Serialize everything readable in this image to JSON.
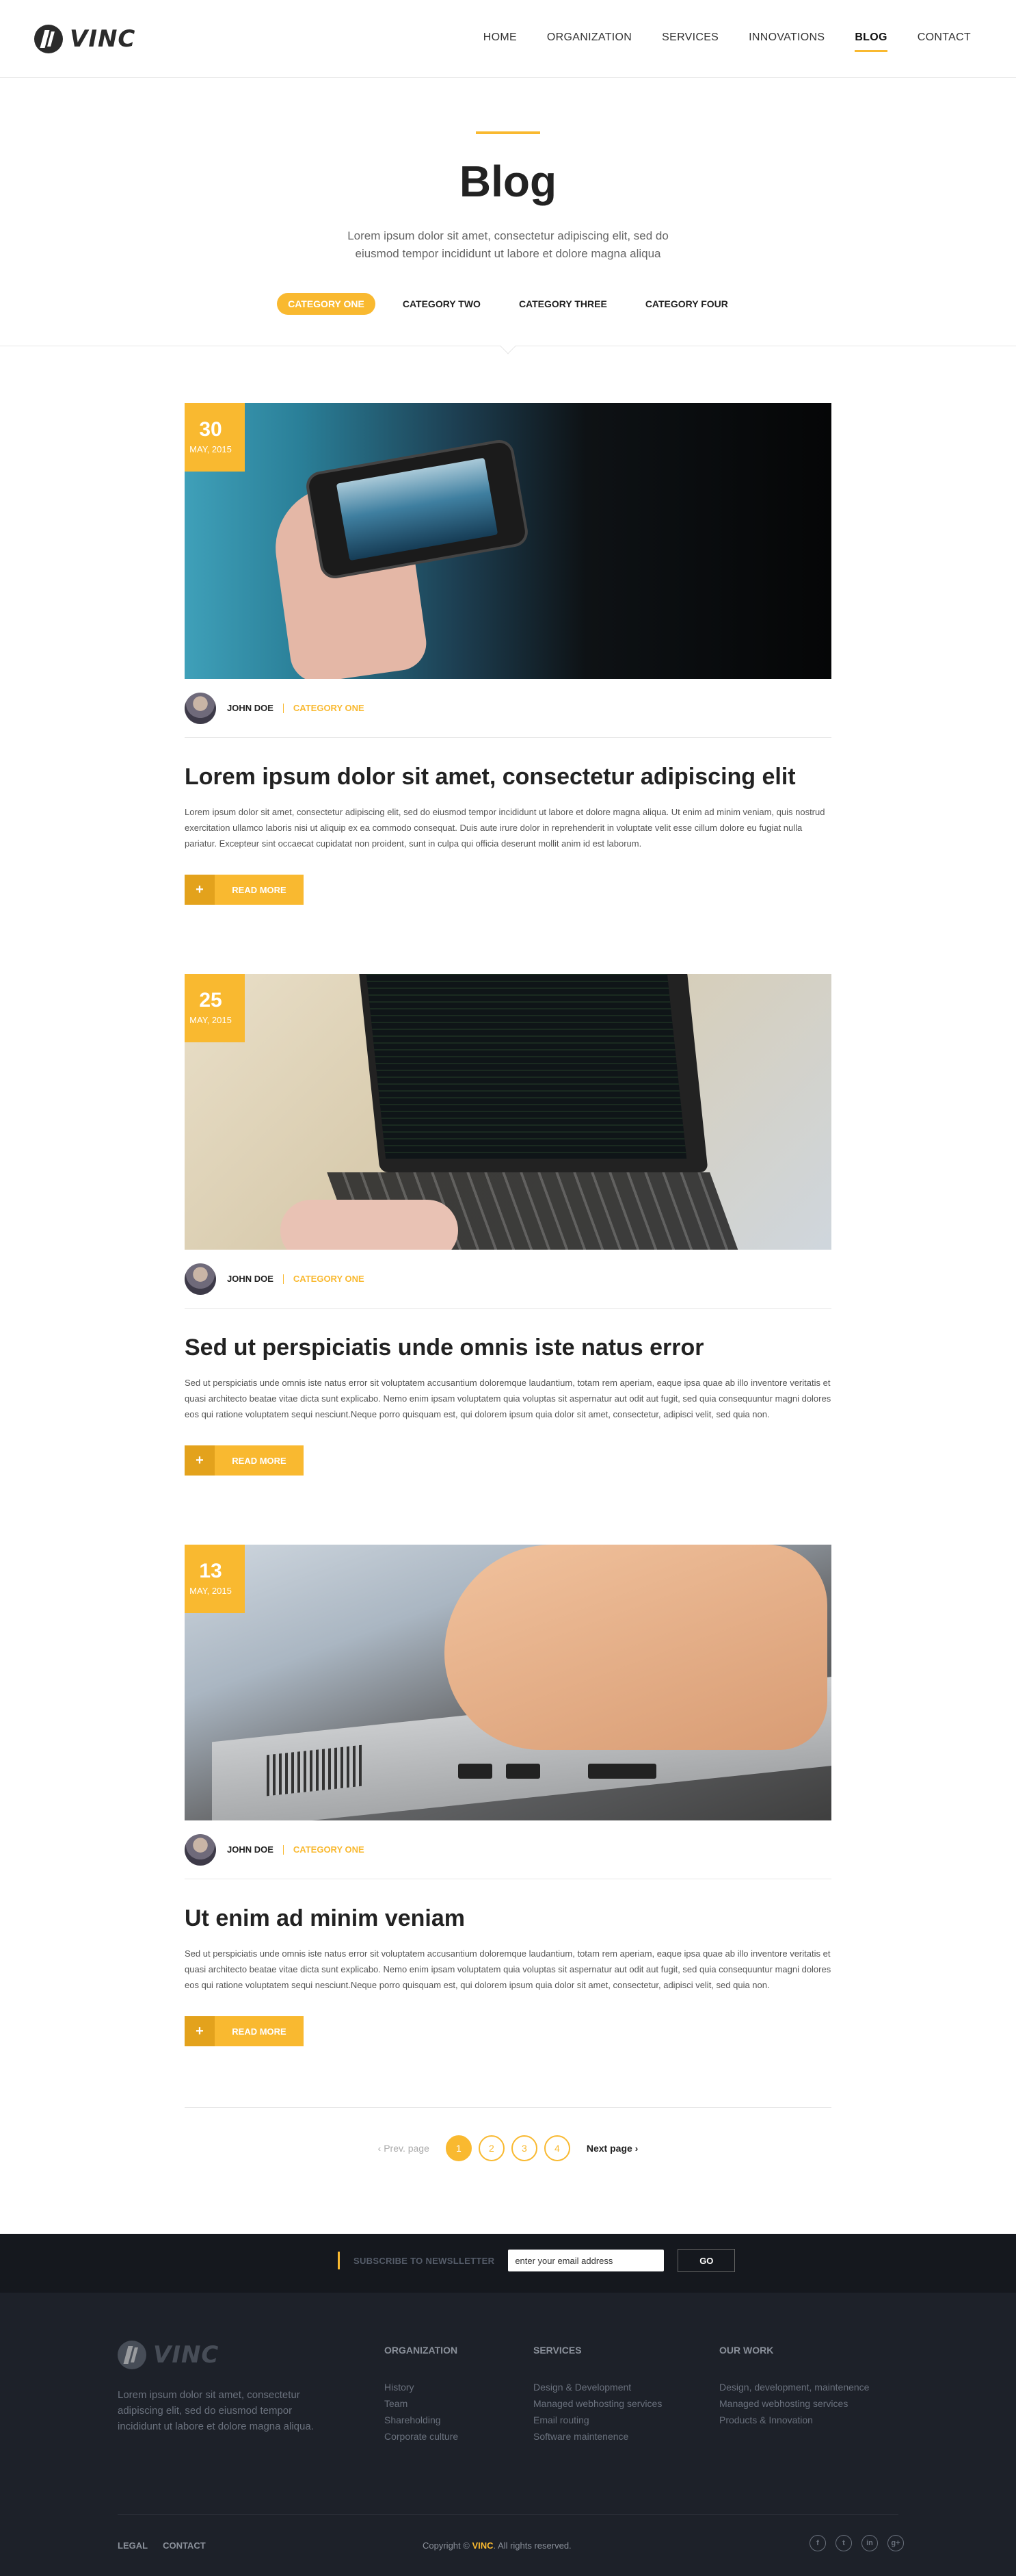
{
  "header": {
    "logo_text": "VINC",
    "nav": [
      "HOME",
      "ORGANIZATION",
      "SERVICES",
      "INNOVATIONS",
      "BLOG",
      "CONTACT"
    ],
    "active_nav": "BLOG"
  },
  "intro": {
    "title": "Blog",
    "text": "Lorem ipsum dolor sit amet, consectetur adipiscing elit, sed do eiusmod tempor incididunt ut labore et dolore magna aliqua",
    "categories": [
      "CATEGORY ONE",
      "CATEGORY TWO",
      "CATEGORY THREE",
      "CATEGORY FOUR"
    ],
    "active_category": "CATEGORY ONE"
  },
  "posts": [
    {
      "day": "30",
      "month": "MAY, 2015",
      "author": "JOHN DOE",
      "category": "CATEGORY ONE",
      "title": "Lorem ipsum dolor sit amet, consectetur adipiscing elit",
      "body": "Lorem ipsum dolor sit amet, consectetur adipiscing elit, sed do eiusmod tempor incididunt ut labore et dolore magna aliqua. Ut enim ad minim veniam, quis nostrud exercitation ullamco laboris nisi ut aliquip ex ea commodo consequat. Duis aute irure dolor in reprehenderit in voluptate velit esse cillum dolore eu fugiat nulla pariatur. Excepteur sint occaecat cupidatat non proident, sunt in culpa qui officia deserunt mollit anim id est laborum.",
      "read_more": "READ MORE"
    },
    {
      "day": "25",
      "month": "MAY, 2015",
      "author": "JOHN DOE",
      "category": "CATEGORY ONE",
      "title": "Sed ut perspiciatis unde omnis iste natus error",
      "body": "Sed ut perspiciatis unde omnis iste natus error sit voluptatem accusantium doloremque laudantium, totam rem aperiam, eaque ipsa quae ab illo inventore veritatis et quasi architecto beatae vitae dicta sunt explicabo. Nemo enim ipsam voluptatem quia voluptas sit aspernatur aut odit aut fugit, sed quia consequuntur magni dolores eos qui ratione voluptatem sequi nesciunt.Neque porro quisquam est, qui dolorem ipsum quia dolor sit amet, consectetur, adipisci velit, sed quia non.",
      "read_more": "READ MORE"
    },
    {
      "day": "13",
      "month": "MAY, 2015",
      "author": "JOHN DOE",
      "category": "CATEGORY ONE",
      "title": "Ut enim ad minim veniam",
      "body": "Sed ut perspiciatis unde omnis iste natus error sit voluptatem accusantium doloremque laudantium, totam rem aperiam, eaque ipsa quae ab illo inventore veritatis et quasi architecto beatae vitae dicta sunt explicabo. Nemo enim ipsam voluptatem quia voluptas sit aspernatur aut odit aut fugit, sed quia consequuntur magni dolores eos qui ratione voluptatem sequi nesciunt.Neque porro quisquam est, qui dolorem ipsum quia dolor sit amet, consectetur, adipisci velit, sed quia non.",
      "read_more": "READ MORE"
    }
  ],
  "pagination": {
    "prev": "Prev. page",
    "next": "Next page",
    "pages": [
      "1",
      "2",
      "3",
      "4"
    ],
    "current": "1"
  },
  "newsletter": {
    "label": "SUBSCRIBE TO NEWSLLETTER",
    "input_value": "enter your email address",
    "button": "GO"
  },
  "footer": {
    "logo_text": "VINC",
    "about": "Lorem ipsum dolor sit amet, consectetur adipiscing elit, sed do eiusmod tempor incididunt ut labore et dolore magna aliqua.",
    "columns": [
      {
        "heading": "ORGANIZATION",
        "links": [
          "History",
          "Team",
          "Shareholding",
          "Corporate culture"
        ]
      },
      {
        "heading": "SERVICES",
        "links": [
          "Design & Development",
          "Managed webhosting services",
          "Email routing",
          "Software maintenence"
        ]
      },
      {
        "heading": "OUR WORK",
        "links": [
          "Design, development, maintenence",
          "Managed webhosting services",
          "Products & Innovation"
        ]
      }
    ],
    "bottom_links": [
      "LEGAL",
      "CONTACT"
    ],
    "copyright_prefix": "Copyright ©",
    "copyright_brand": "VINC",
    "copyright_suffix": ". All rights reserved.",
    "social": [
      "facebook-icon",
      "twitter-icon",
      "linkedin-icon",
      "googleplus-icon"
    ]
  },
  "colors": {
    "accent": "#f9b930",
    "footer_bg": "#1d2129",
    "newsletter_bg": "#15181e"
  }
}
